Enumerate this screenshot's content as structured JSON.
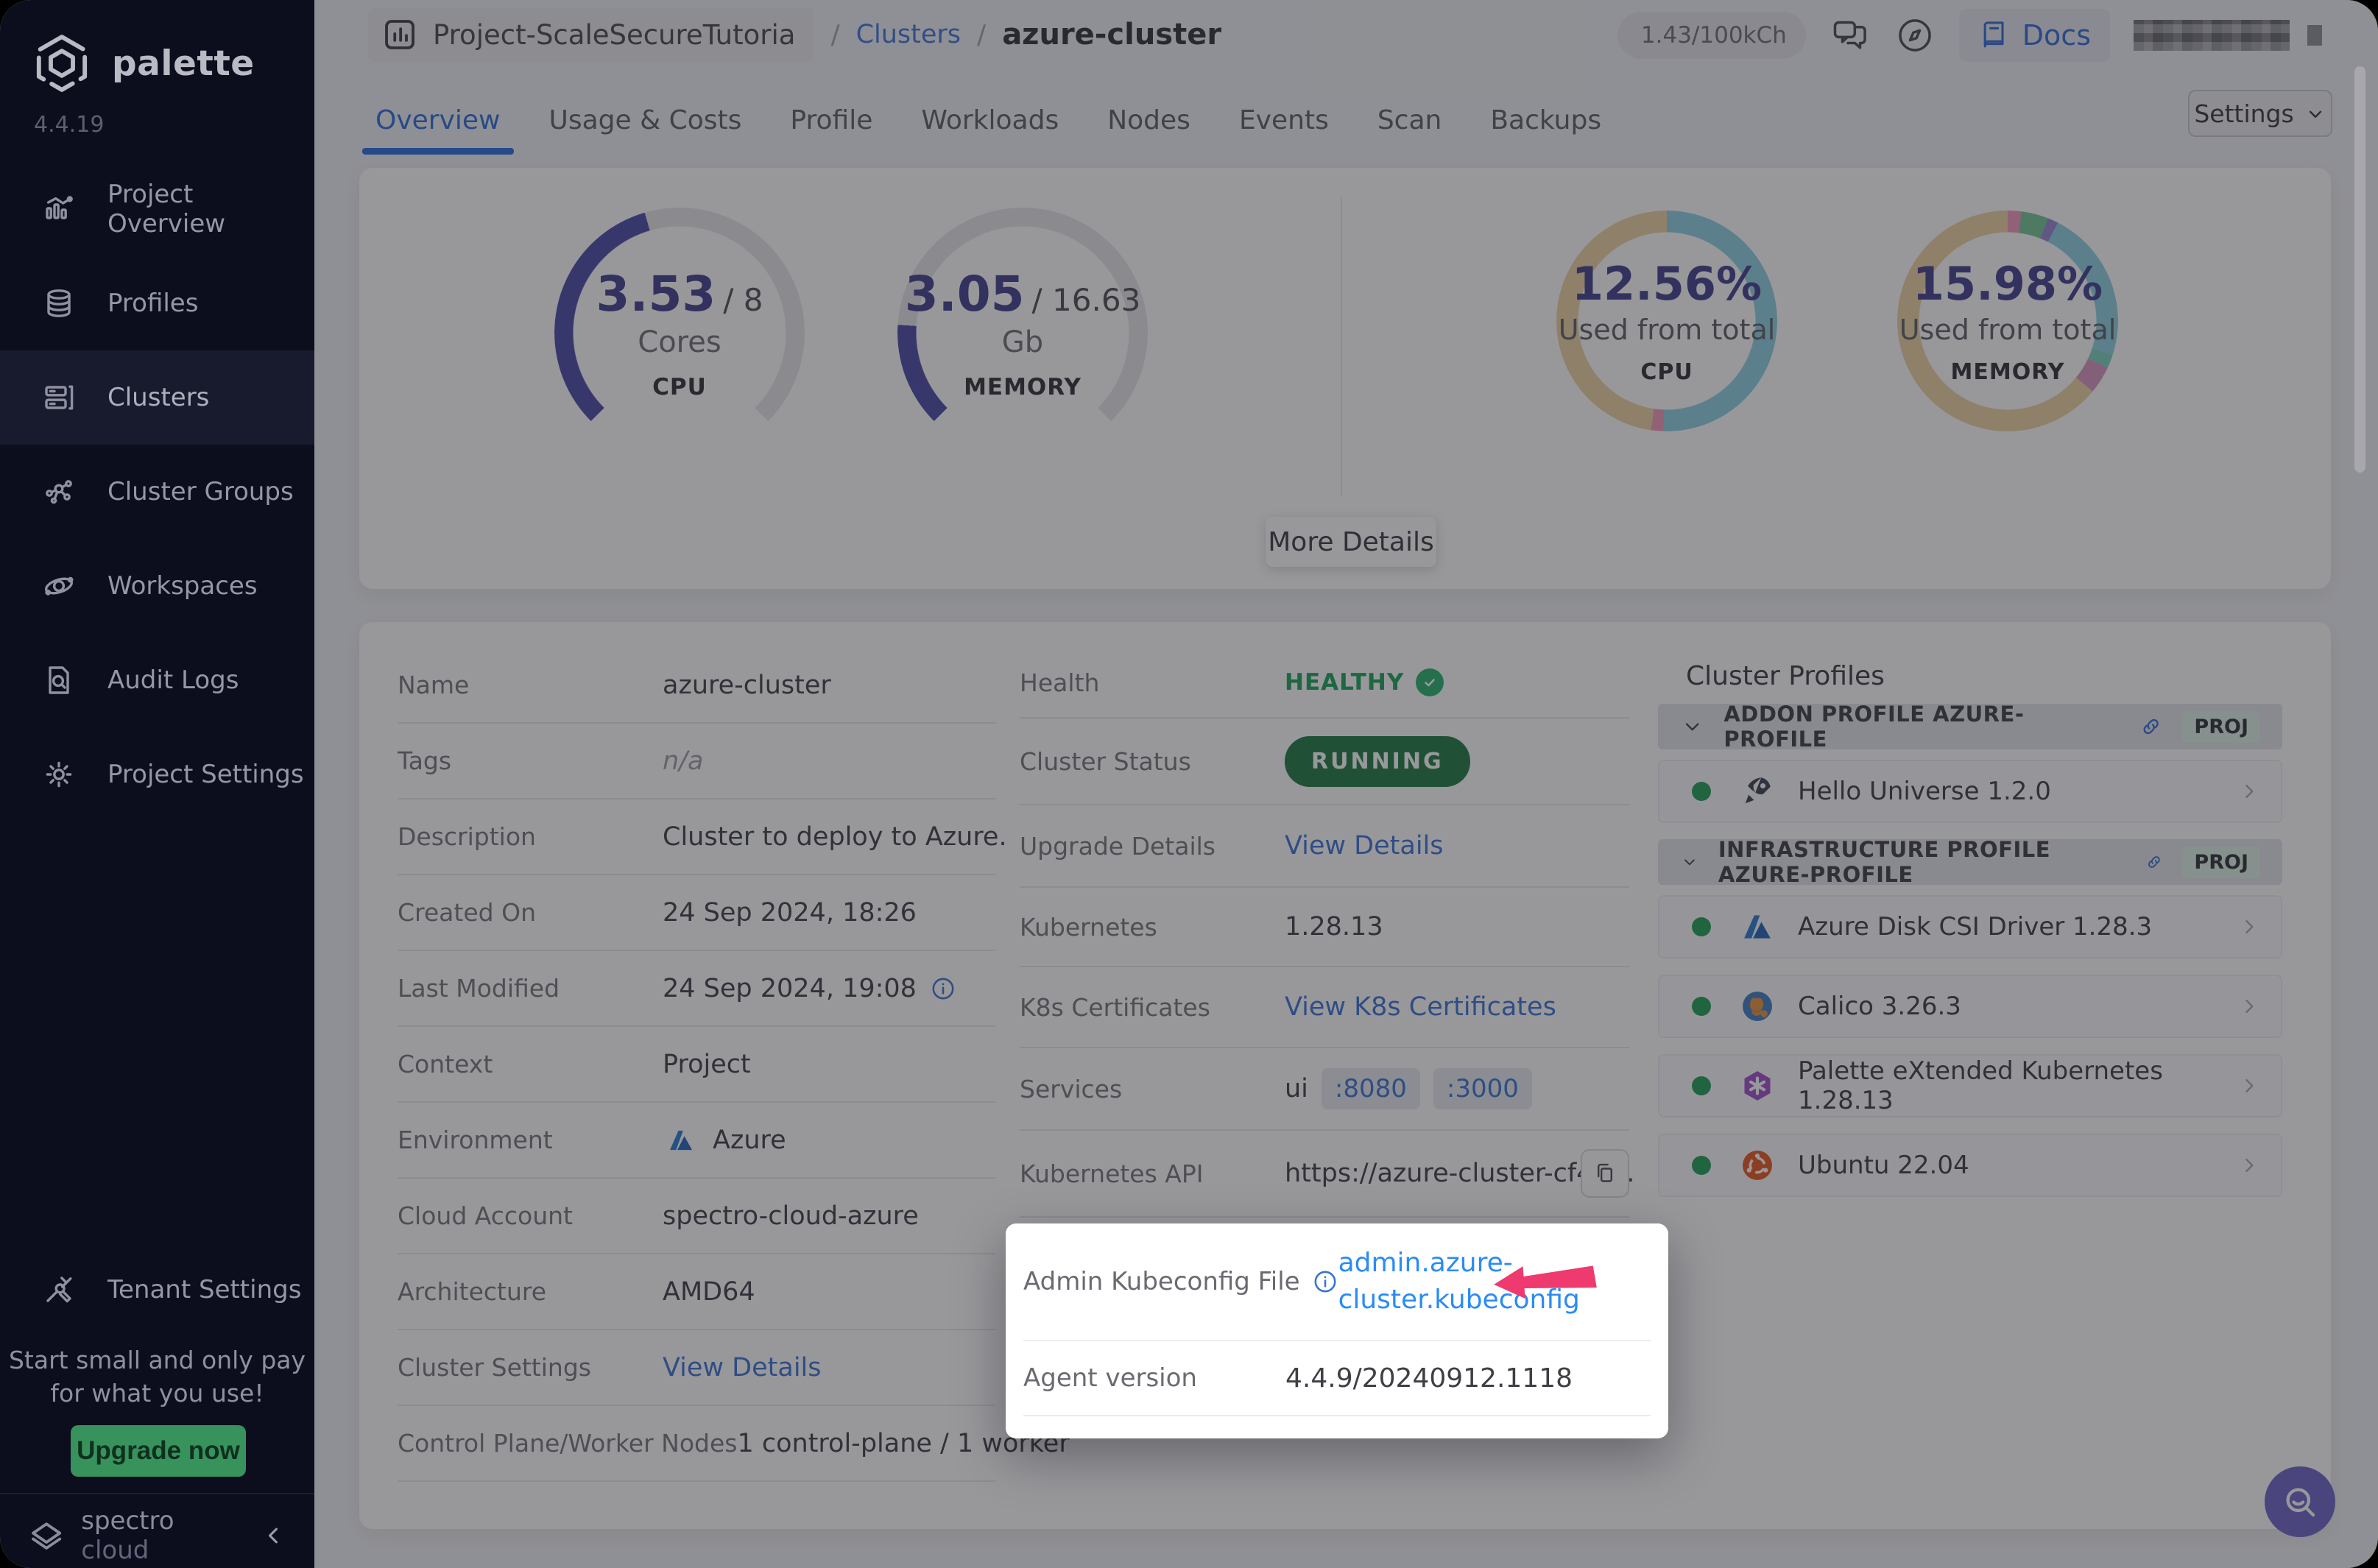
{
  "app": {
    "brand": "palette",
    "version": "4.4.19"
  },
  "sidebar": {
    "items": [
      {
        "id": "project-overview",
        "label": "Project Overview",
        "icon": "chart"
      },
      {
        "id": "profiles",
        "label": "Profiles",
        "icon": "layers"
      },
      {
        "id": "clusters",
        "label": "Clusters",
        "icon": "server",
        "active": true
      },
      {
        "id": "cluster-groups",
        "label": "Cluster Groups",
        "icon": "network"
      },
      {
        "id": "workspaces",
        "label": "Workspaces",
        "icon": "orbit"
      },
      {
        "id": "audit-logs",
        "label": "Audit Logs",
        "icon": "audit"
      },
      {
        "id": "project-settings",
        "label": "Project Settings",
        "icon": "gear"
      }
    ],
    "tenant_label": "Tenant Settings",
    "upsell": {
      "line1": "Start small and only pay",
      "line2": "for what you use!",
      "cta": "Upgrade now"
    },
    "footer": {
      "brand_bold": "spectro",
      "brand_light": "cloud"
    }
  },
  "topbar": {
    "project": "Project-ScaleSecureTutoria",
    "separator": "/",
    "clusters_link": "Clusters",
    "cluster_name": "azure-cluster",
    "usage_pill": "1.43/100kCh",
    "docs_label": "Docs"
  },
  "tabs": {
    "items": [
      "Overview",
      "Usage & Costs",
      "Profile",
      "Workloads",
      "Nodes",
      "Events",
      "Scan",
      "Backups"
    ],
    "active_index": 0,
    "settings_label": "Settings"
  },
  "metrics": {
    "gauges": [
      {
        "id": "cpu",
        "value": "3.53",
        "total": "/ 8",
        "unit": "Cores",
        "label": "CPU",
        "fill_fraction": 0.44
      },
      {
        "id": "memory",
        "value": "3.05",
        "total": "/ 16.63",
        "unit": "Gb",
        "label": "MEMORY",
        "fill_fraction": 0.18
      }
    ],
    "donuts": [
      {
        "id": "cpu",
        "percent": "12.56%",
        "caption": "Used from total",
        "label": "CPU",
        "segments": [
          {
            "color": "#8fd0e2",
            "pct": 50.5
          },
          {
            "color": "#f29ab9",
            "pct": 1.8
          },
          {
            "color": "#ecd2a0",
            "pct": 47.7
          }
        ]
      },
      {
        "id": "memory",
        "percent": "15.98%",
        "caption": "Used from total",
        "label": "MEMORY",
        "segments": [
          {
            "color": "#f29ab9",
            "pct": 2
          },
          {
            "color": "#74c494",
            "pct": 4
          },
          {
            "color": "#9a82d6",
            "pct": 1.5
          },
          {
            "color": "#8fd0e2",
            "pct": 22.5
          },
          {
            "color": "#7fd0bd",
            "pct": 2
          },
          {
            "color": "#d793c0",
            "pct": 4
          },
          {
            "color": "#ecd2a0",
            "pct": 64
          }
        ]
      }
    ],
    "more_details_label": "More Details"
  },
  "details": {
    "left": [
      {
        "label": "Name",
        "value": "azure-cluster",
        "type": "text"
      },
      {
        "label": "Tags",
        "value": "n/a",
        "type": "muted"
      },
      {
        "label": "Description",
        "value": "Cluster to deploy to Azure.",
        "type": "text"
      },
      {
        "label": "Created On",
        "value": "24 Sep 2024, 18:26",
        "type": "text"
      },
      {
        "label": "Last Modified",
        "value": "24 Sep 2024, 19:08",
        "type": "text-info"
      },
      {
        "label": "Context",
        "value": "Project",
        "type": "text"
      },
      {
        "label": "Environment",
        "value": "Azure",
        "type": "azure"
      },
      {
        "label": "Cloud Account",
        "value": "spectro-cloud-azure",
        "type": "text"
      },
      {
        "label": "Architecture",
        "value": "AMD64",
        "type": "text"
      },
      {
        "label": "Cluster Settings",
        "value": "View Details",
        "type": "link"
      },
      {
        "label": "Control Plane/Worker Nodes",
        "value": "1 control-plane / 1 worker",
        "type": "text"
      }
    ],
    "right": [
      {
        "label": "Health",
        "value": "HEALTHY",
        "type": "health",
        "h": 96
      },
      {
        "label": "Cluster Status",
        "value": "RUNNING",
        "type": "pill",
        "h": 118
      },
      {
        "label": "Upgrade Details",
        "value": "View Details",
        "type": "link",
        "h": 112
      },
      {
        "label": "Kubernetes",
        "value": "1.28.13",
        "type": "text",
        "h": 108
      },
      {
        "label": "K8s Certificates",
        "value": "View K8s Certificates",
        "type": "link",
        "h": 110
      },
      {
        "label": "Services",
        "value": "ui",
        "type": "ports",
        "ports": [
          ":8080",
          ":3000"
        ],
        "h": 112
      },
      {
        "label": "Kubernetes API",
        "value": "https://azure-cluster-cf42…",
        "type": "api",
        "h": 118
      }
    ]
  },
  "spotlight": {
    "label": "Admin Kubeconfig File",
    "link_line1": "admin.azure-",
    "link_line2": "cluster.kubeconfig",
    "agent_label": "Agent version",
    "agent_value": "4.4.9/20240912.1118"
  },
  "cluster_profiles": {
    "title": "Cluster Profiles",
    "groups": [
      {
        "header": "ADDON PROFILE AZURE-PROFILE",
        "badge": "PROJ",
        "items": [
          {
            "name": "Hello Universe 1.2.0",
            "icon": "rocket"
          }
        ]
      },
      {
        "header": "INFRASTRUCTURE PROFILE AZURE-PROFILE",
        "badge": "PROJ",
        "items": [
          {
            "name": "Azure Disk CSI Driver 1.28.3",
            "icon": "azure"
          },
          {
            "name": "Calico 3.26.3",
            "icon": "calico"
          },
          {
            "name": "Palette eXtended Kubernetes 1.28.13",
            "icon": "pxk"
          },
          {
            "name": "Ubuntu 22.04",
            "icon": "ubuntu"
          }
        ]
      }
    ]
  },
  "colors": {
    "accent_blue": "#2c6bd9",
    "link_blue": "#3a72d4",
    "bright_link": "#2a8cf4",
    "running_green": "#1e7a41",
    "healthy_green": "#17a257",
    "status_dot_green": "#1f9e54",
    "gauge_indigo": "#4a48a6",
    "pink_arrow": "#ee3a6f",
    "sidebar_bg": "#0c0e1d",
    "fab_purple": "#6f63c8"
  }
}
